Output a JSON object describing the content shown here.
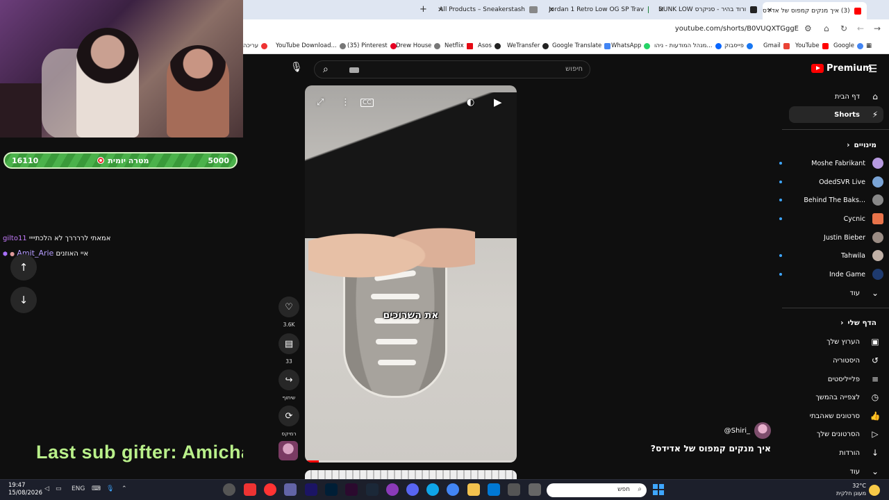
{
  "browser": {
    "tabs": [
      {
        "title": "(3) איך מנקים קמפוס של אדידס",
        "active": true
      },
      {
        "title": "ורוד בהיר - סניקרס DUNK LOW",
        "active": false
      },
      {
        "title": "Jordan 1 Retro Low OG SP Trav",
        "active": false
      },
      {
        "title": "All Products – Sneakerstash",
        "active": false
      }
    ],
    "url": "youtube.com/shorts/B0VUQXTGggE",
    "bookmarks": [
      "Google",
      "YouTube",
      "Gmail",
      "פייסבוק",
      "מנהל המודעות - ניהו...",
      "WhatsApp",
      "Google Translate",
      "WeTransfer",
      "Asos",
      "Netflix",
      "Drew House",
      "(35) Pinterest",
      "YouTube Download...",
      "עריכה"
    ]
  },
  "stream": {
    "goal_current": "16110",
    "goal_label": "מטרה יומית",
    "goal_target": "5000",
    "chat": [
      {
        "user": "gilto11",
        "message": "אמאתי לררררך לא הלכתיייי"
      },
      {
        "user": "Amit_Arie",
        "message": "איי האוזנים"
      }
    ],
    "sub_gifter": "Last sub gifter: Amichai"
  },
  "youtube": {
    "logo_text": "Premium",
    "search_placeholder": "חיפוש",
    "caption": "את השרוכים",
    "likes": "3.6K",
    "comments": "33",
    "share_label": "שיתוף",
    "remix_label": "רמיקס",
    "channel": "@Shiri_",
    "video_title": "איך מנקים קמפוס של אדידס?",
    "sidebar": {
      "home": "דף הבית",
      "shorts": "Shorts",
      "subscriptions_header": "מינויים",
      "subscriptions": [
        "Moshe Fabrikant",
        "OdedSVR Live",
        "Behind The Baks...",
        "Cycnic",
        "Justin Bieber",
        "Tahwila",
        "Inde Game"
      ],
      "more": "עוד",
      "you_header": "הדף שלי",
      "you_items": [
        "הערוץ שלך",
        "היסטוריה",
        "פלייליסטים",
        "לצפייה בהמשך",
        "סרטונים שאהבתי",
        "הסרטונים שלך",
        "הורדות"
      ],
      "more2": "עוד"
    }
  },
  "taskbar": {
    "time": "19:47",
    "date": "15/08/2026",
    "lang": "ENG",
    "search_placeholder": "חפש",
    "temperature": "32°C",
    "weather_desc": "מעונן חלקית"
  }
}
